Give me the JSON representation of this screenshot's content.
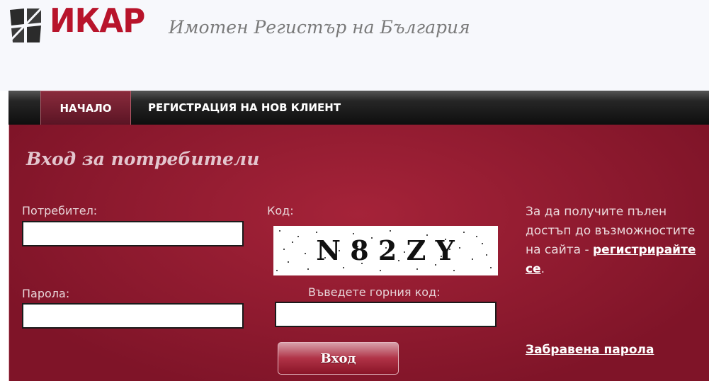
{
  "header": {
    "logo_text": "ИКАР",
    "tagline": "Имотен Регистър на България"
  },
  "nav": {
    "home": "НАЧАЛО",
    "register": "РЕГИСТРАЦИЯ НА НОВ КЛИЕНТ"
  },
  "login": {
    "title": "Вход за потребители",
    "username_label": "Потребител:",
    "username_value": "",
    "password_label": "Парола:",
    "password_value": "",
    "code_label": "Код:",
    "captcha_text": "N 8 2 Z Y",
    "captcha_prompt": "Въведете горния код:",
    "captcha_value": "",
    "submit": "Вход"
  },
  "info": {
    "text": "За да получите пълен достъп до възможностите на сайта -",
    "register_link": "регистрирайте се",
    "period": ".",
    "forgot_password": "Забравена парола"
  },
  "colors": {
    "brand_red": "#b8142b",
    "panel_red": "#8f1a2f",
    "navbar": "#1a1a1a"
  }
}
